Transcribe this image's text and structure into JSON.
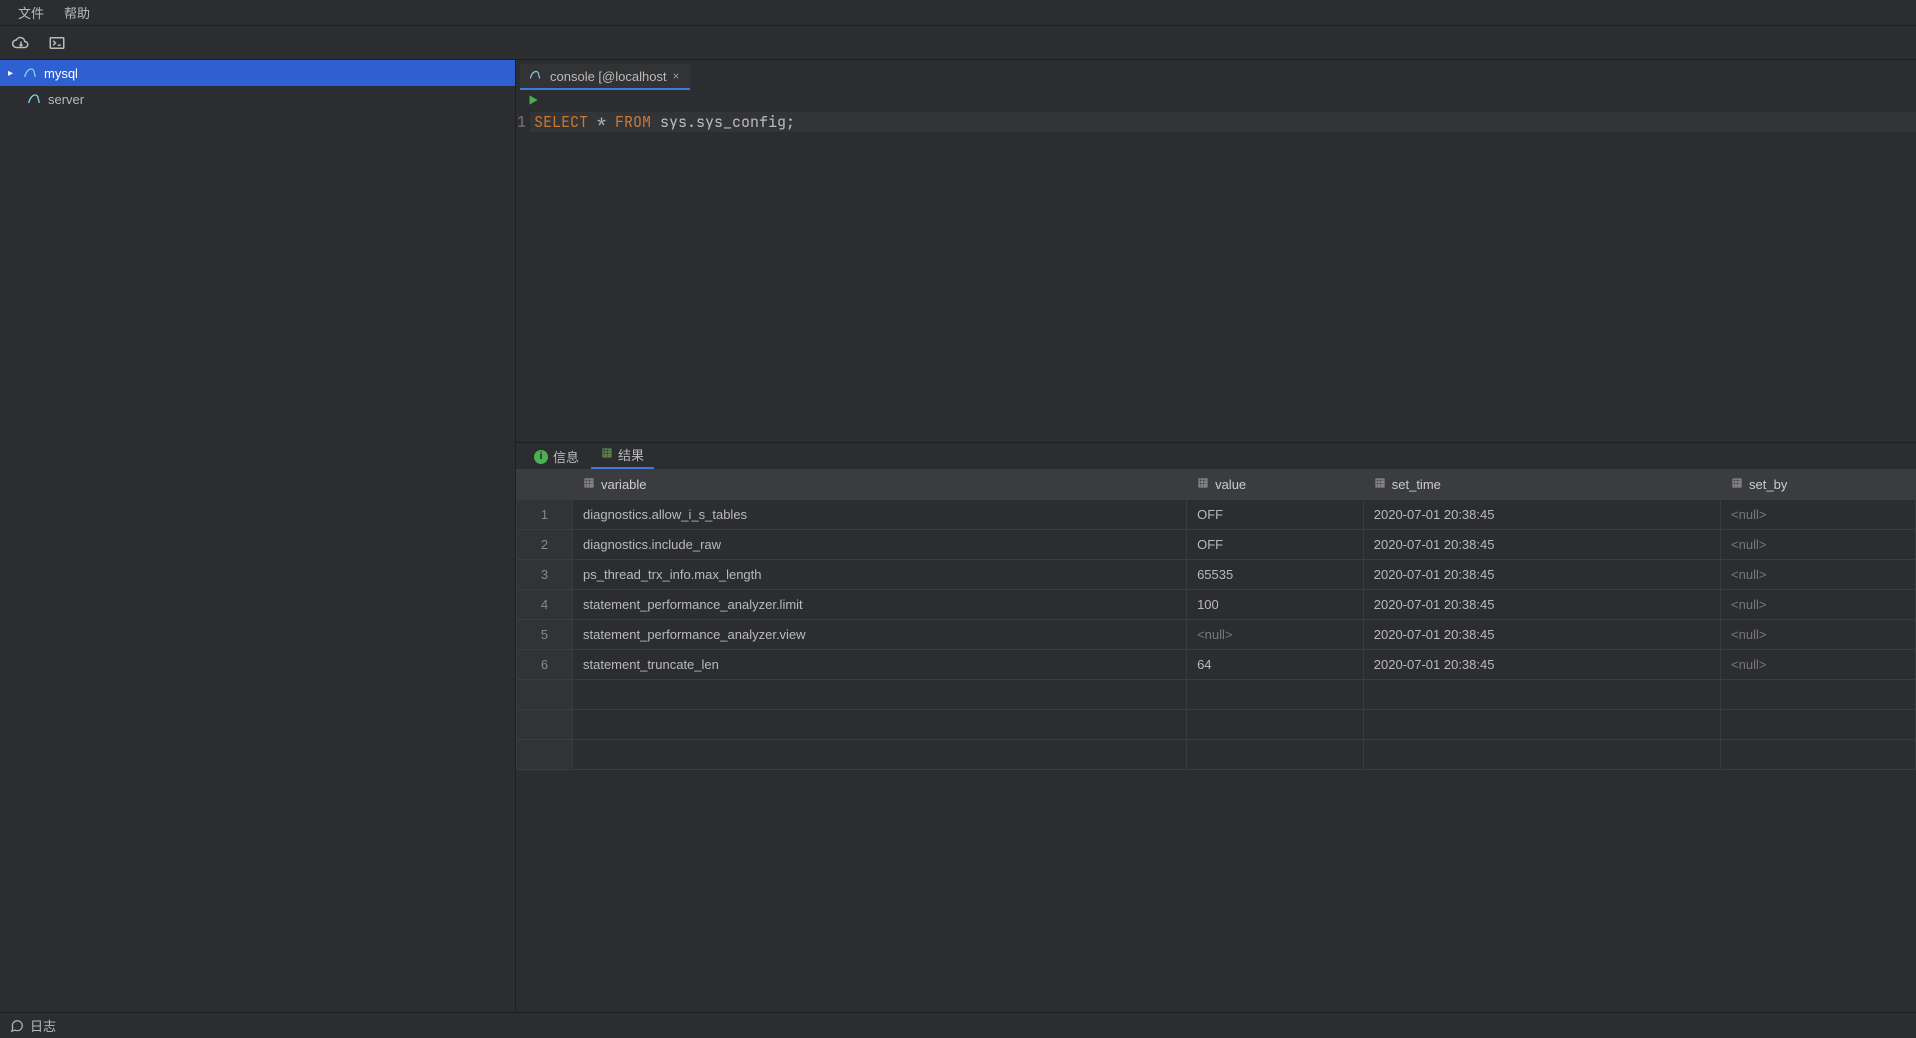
{
  "menubar": {
    "file": "文件",
    "help": "帮助"
  },
  "sidebar": {
    "items": [
      {
        "label": "mysql",
        "selected": true,
        "expandable": true
      },
      {
        "label": "server",
        "selected": false,
        "expandable": false
      }
    ]
  },
  "editor": {
    "tab_label": "console [@localhost",
    "line_number": "1",
    "sql_keyword1": "SELECT",
    "sql_star": " * ",
    "sql_keyword2": "FROM",
    "sql_rest": " sys.sys_config;"
  },
  "result_tabs": {
    "info": "信息",
    "result": "结果"
  },
  "grid": {
    "columns": [
      "variable",
      "value",
      "set_time",
      "set_by"
    ],
    "rows": [
      {
        "n": "1",
        "variable": "diagnostics.allow_i_s_tables",
        "value": "OFF",
        "set_time": "2020-07-01 20:38:45",
        "set_by": "<null>"
      },
      {
        "n": "2",
        "variable": "diagnostics.include_raw",
        "value": "OFF",
        "set_time": "2020-07-01 20:38:45",
        "set_by": "<null>"
      },
      {
        "n": "3",
        "variable": "ps_thread_trx_info.max_length",
        "value": "65535",
        "set_time": "2020-07-01 20:38:45",
        "set_by": "<null>"
      },
      {
        "n": "4",
        "variable": "statement_performance_analyzer.limit",
        "value": "100",
        "set_time": "2020-07-01 20:38:45",
        "set_by": "<null>"
      },
      {
        "n": "5",
        "variable": "statement_performance_analyzer.view",
        "value": "<null>",
        "set_time": "2020-07-01 20:38:45",
        "set_by": "<null>"
      },
      {
        "n": "6",
        "variable": "statement_truncate_len",
        "value": "64",
        "set_time": "2020-07-01 20:38:45",
        "set_by": "<null>"
      }
    ]
  },
  "statusbar": {
    "log": "日志"
  }
}
